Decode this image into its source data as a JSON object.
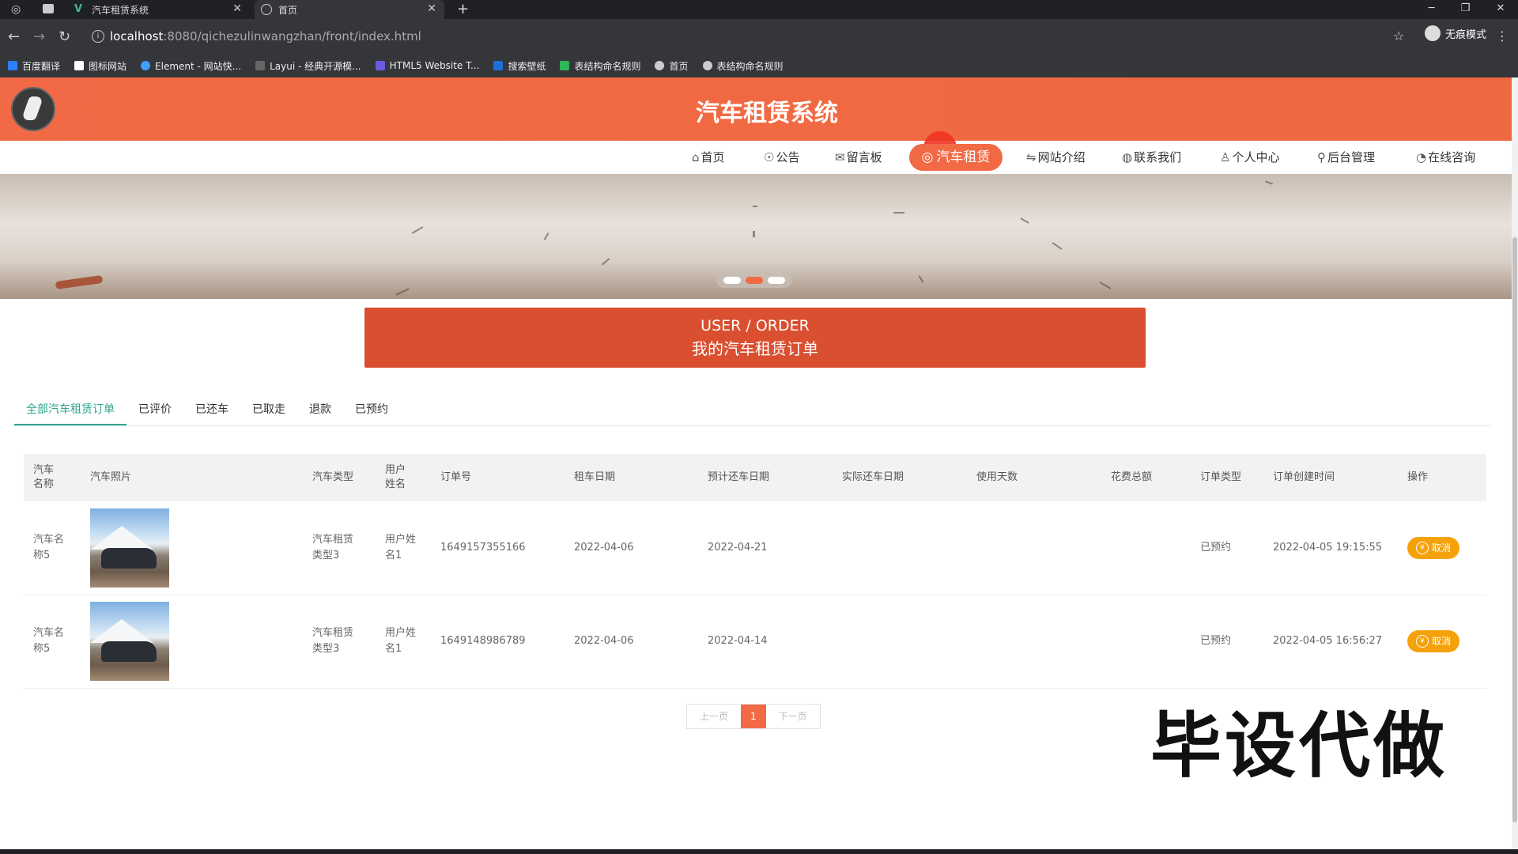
{
  "browser": {
    "tabs": [
      {
        "title": "汽车租赁系统",
        "icon": "vue-icon"
      },
      {
        "title": "首页",
        "icon": "globe-icon"
      }
    ],
    "url_host": "localhost",
    "url_path": ":8080/qichezulinwangzhan/front/index.html",
    "incognito_label": "无痕模式",
    "bookmarks": [
      "百度翻译",
      "图标网站",
      "Element - 网站快...",
      "Layui - 经典开源模...",
      "HTML5 Website T...",
      "搜索壁纸",
      "表结构命名规则",
      "首页",
      "表结构命名规则"
    ]
  },
  "site": {
    "title": "汽车租赁系统",
    "nav": [
      {
        "label": "首页",
        "icon": "home-icon"
      },
      {
        "label": "公告",
        "icon": "bell-icon"
      },
      {
        "label": "留言板",
        "icon": "mail-icon"
      },
      {
        "label": "汽车租赁",
        "icon": "car-icon",
        "active": true
      },
      {
        "label": "网站介绍",
        "icon": "sliders-icon"
      },
      {
        "label": "联系我们",
        "icon": "globe-icon"
      },
      {
        "label": "个人中心",
        "icon": "user-icon"
      },
      {
        "label": "后台管理",
        "icon": "link-icon"
      },
      {
        "label": "在线咨询",
        "icon": "chat-icon"
      }
    ],
    "accent": "#f26a45"
  },
  "section": {
    "en": "USER / ORDER",
    "cn": "我的汽车租赁订单"
  },
  "order_tabs": [
    "全部汽车租赁订单",
    "已评价",
    "已还车",
    "已取走",
    "退款",
    "已预约"
  ],
  "table": {
    "headers": [
      "汽车名称",
      "汽车照片",
      "汽车类型",
      "用户姓名",
      "订单号",
      "租车日期",
      "预计还车日期",
      "实际还车日期",
      "使用天数",
      "花费总额",
      "订单类型",
      "订单创建时间",
      "操作"
    ],
    "rows": [
      {
        "car_name": "汽车名称5",
        "car_type": "汽车租赁类型3",
        "user_name": "用户姓名1",
        "order_no": "1649157355166",
        "rent_date": "2022-04-06",
        "expected_return": "2022-04-21",
        "actual_return": "",
        "days": "",
        "total": "",
        "order_type": "已预约",
        "created": "2022-04-05 19:15:55",
        "action": "取消"
      },
      {
        "car_name": "汽车名称5",
        "car_type": "汽车租赁类型3",
        "user_name": "用户姓名1",
        "order_no": "1649148986789",
        "rent_date": "2022-04-06",
        "expected_return": "2022-04-14",
        "actual_return": "",
        "days": "",
        "total": "",
        "order_type": "已预约",
        "created": "2022-04-05 16:56:27",
        "action": "取消"
      }
    ]
  },
  "pagination": {
    "prev": "上一页",
    "current": "1",
    "next": "下一页"
  },
  "watermark": "毕设代做"
}
